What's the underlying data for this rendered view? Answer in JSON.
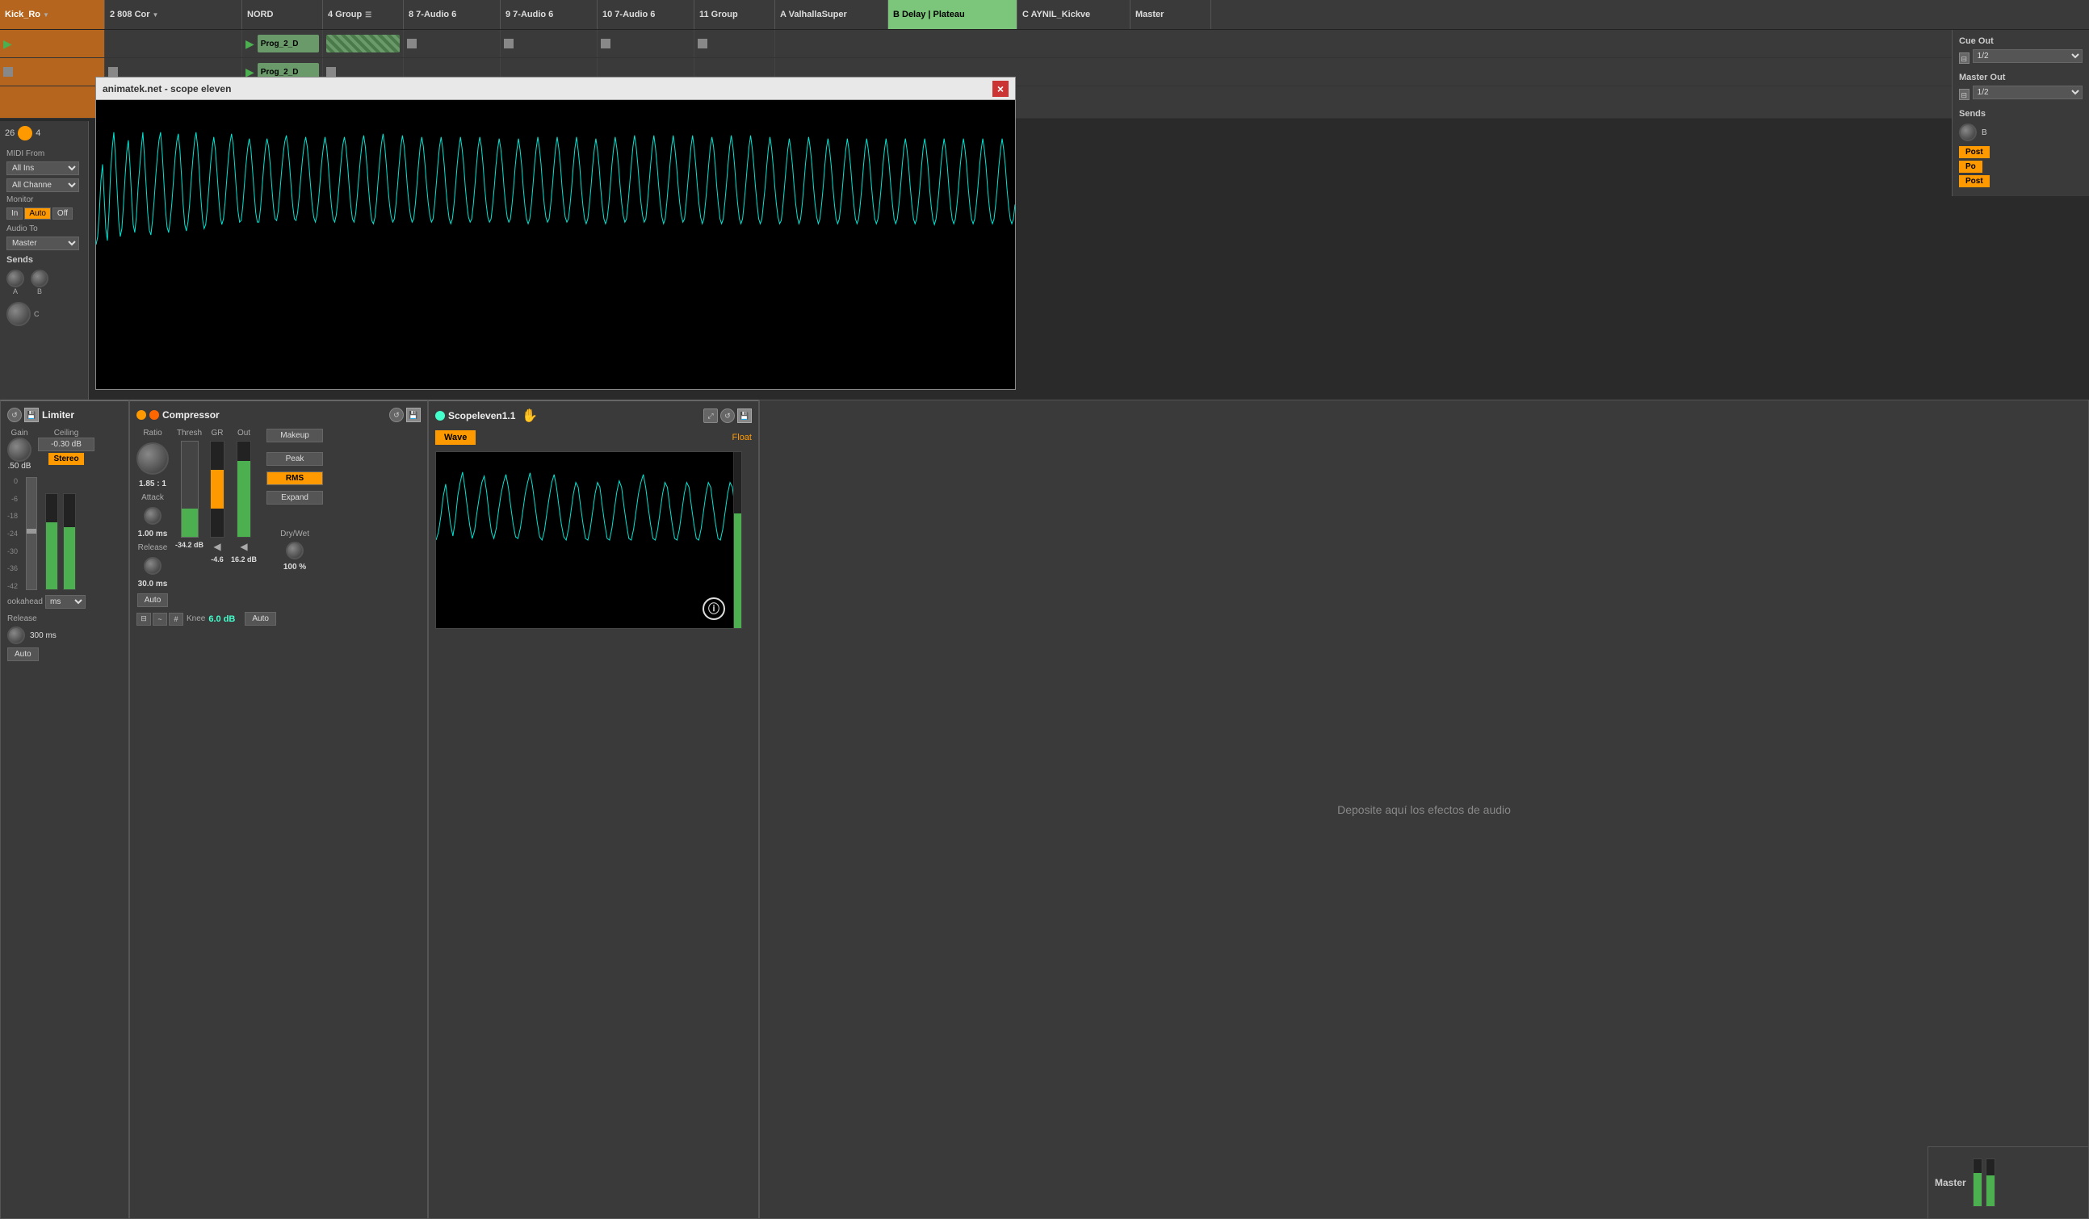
{
  "tracks": {
    "items": [
      {
        "label": "Kick_Ro",
        "type": "kick",
        "hasArrow": true
      },
      {
        "label": "2 808 Cor",
        "type": "cor",
        "hasArrow": true
      },
      {
        "label": "NORD",
        "type": "nord"
      },
      {
        "label": "4 Group",
        "type": "group4",
        "hasEq": true
      },
      {
        "label": "8 7-Audio 6",
        "type": "audio6"
      },
      {
        "label": "9 7-Audio 6",
        "type": "audio6b"
      },
      {
        "label": "10 7-Audio 6",
        "type": "audio6c"
      },
      {
        "label": "11 Group",
        "type": "group11"
      },
      {
        "label": "A ValhallaSuper",
        "type": "valhalla"
      },
      {
        "label": "B Delay | Plateau",
        "type": "delay"
      },
      {
        "label": "C AYNIL_Kickve",
        "type": "aynil"
      },
      {
        "label": "Master",
        "type": "master"
      }
    ]
  },
  "scope_window": {
    "title": "animatek.net - scope eleven",
    "close_label": "×"
  },
  "row_counter": {
    "value": "26",
    "extra": "4"
  },
  "midi_from": {
    "label": "MIDI From",
    "ins_label": "All Ins",
    "channel_label": "All Channe"
  },
  "monitor": {
    "label": "Monitor",
    "in_label": "In",
    "auto_label": "Auto",
    "off_label": "Off"
  },
  "audio_to": {
    "label": "Audio To",
    "value": "Master"
  },
  "sends": {
    "label": "Sends",
    "a_label": "A",
    "b_label": "B",
    "c_label": "C"
  },
  "cue_out": {
    "label": "Cue Out",
    "value": "1/2"
  },
  "master_out": {
    "label": "Master Out",
    "value": "1/2"
  },
  "right_sends": {
    "label": "Sends",
    "b_label": "B",
    "post_label": "Post",
    "po_label": "Po"
  },
  "limiter": {
    "title": "Limiter",
    "gain_label": "Gain",
    "ceiling_label": "Ceiling",
    "ceiling_value": "-0.30 dB",
    "stereo_label": "Stereo",
    "lookahead_label": "ookahead",
    "ms_label": "ms",
    "release_label": "Release",
    "ms_val": "300 ms",
    "auto_label": "Auto",
    "db_val": ".50 dB",
    "scale": [
      "0",
      "-6",
      "-18",
      "-24",
      "-30",
      "-36",
      "-42"
    ]
  },
  "compressor": {
    "title": "Compressor",
    "ratio_label": "Ratio",
    "ratio_value": "1.85 : 1",
    "attack_label": "Attack",
    "attack_value": "1.00 ms",
    "release_label": "Release",
    "release_value": "30.0 ms",
    "thresh_label": "Thresh",
    "gr_label": "GR",
    "out_label": "Out",
    "thresh_value": "-34.2 dB",
    "gr_value": "-4.6",
    "out_value": "16.2 dB",
    "makeup_label": "Makeup",
    "peak_label": "Peak",
    "rms_label": "RMS",
    "expand_label": "Expand",
    "drywet_label": "Dry/Wet",
    "drywet_value": "100 %",
    "knee_label": "Knee",
    "knee_value": "6.0 dB",
    "auto_label": "Auto"
  },
  "scopeleven": {
    "title": "Scopeleven1.1",
    "wave_label": "Wave",
    "float_label": "Float",
    "drop_text": "Deposite aquí los efectos de audio"
  },
  "clips": {
    "prog2d_1": "Prog_2_D",
    "prog2d_2": "Prog_2_D"
  },
  "master_bottom": {
    "label": "Master"
  }
}
